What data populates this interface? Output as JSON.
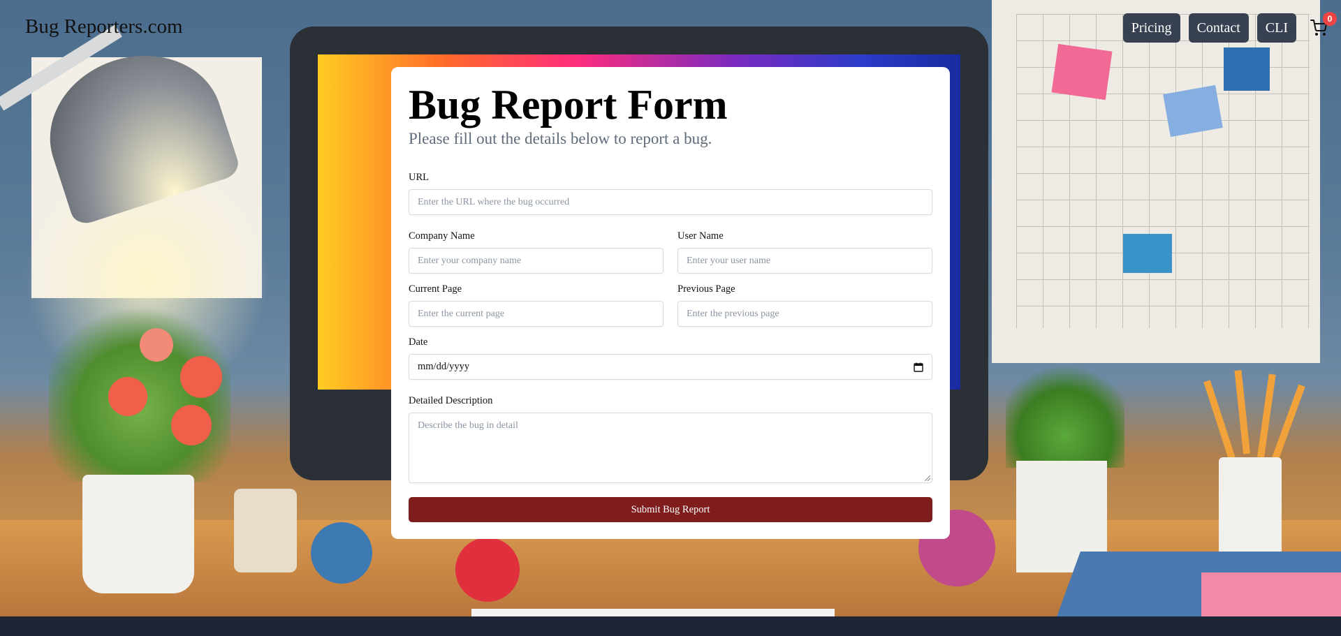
{
  "header": {
    "brand": "Bug Reporters.com",
    "nav": [
      {
        "label": "Pricing"
      },
      {
        "label": "Contact"
      },
      {
        "label": "CLI"
      }
    ],
    "cart": {
      "icon": "shopping-cart-icon",
      "count": "0"
    }
  },
  "form": {
    "title": "Bug Report Form",
    "subtitle": "Please fill out the details below to report a bug.",
    "url": {
      "label": "URL",
      "placeholder": "Enter the URL where the bug occurred"
    },
    "company": {
      "label": "Company Name",
      "placeholder": "Enter your company name"
    },
    "user": {
      "label": "User Name",
      "placeholder": "Enter your user name"
    },
    "current_page": {
      "label": "Current Page",
      "placeholder": "Enter the current page"
    },
    "previous_page": {
      "label": "Previous Page",
      "placeholder": "Enter the previous page"
    },
    "date": {
      "label": "Date",
      "value": "mm/dd/yyyy",
      "icon": "calendar-icon"
    },
    "description": {
      "label": "Detailed Description",
      "placeholder": "Describe the bug in detail"
    },
    "submit_label": "Submit Bug Report"
  },
  "colors": {
    "nav_button": "#374151",
    "submit_button": "#7f1d1d",
    "badge": "#ef4444",
    "footer": "#1d2536"
  }
}
